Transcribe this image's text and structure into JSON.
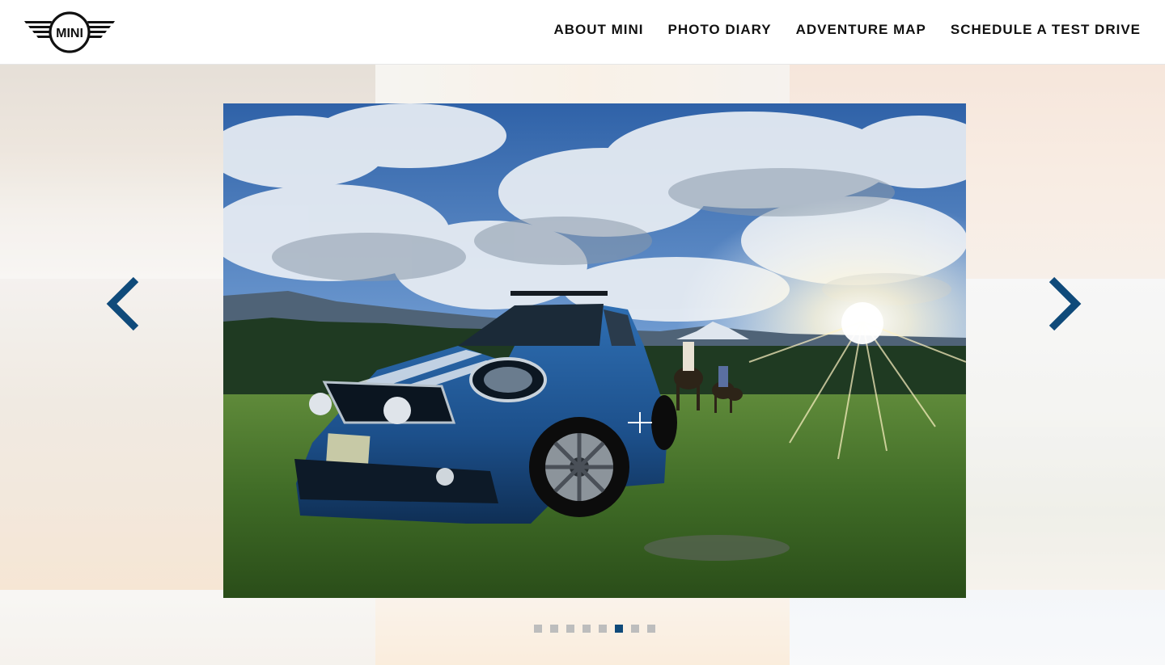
{
  "brand": {
    "logo_text": "MINI",
    "logo_name": "mini-wings-logo"
  },
  "nav": {
    "items": [
      {
        "label": "ABOUT MINI"
      },
      {
        "label": "PHOTO DIARY"
      },
      {
        "label": "ADVENTURE MAP"
      },
      {
        "label": "SCHEDULE A TEST DRIVE"
      }
    ]
  },
  "carousel": {
    "prev_icon": "chevron-left-icon",
    "next_icon": "chevron-right-icon",
    "photo_subject": "blue MINI Countryman in a grassy meadow with riders on horseback and sun flare",
    "slide_count": 8,
    "active_index": 5
  },
  "colors": {
    "accent": "#0f4a7a",
    "dot_inactive": "#bdbdbd",
    "nav_text": "#111111"
  }
}
